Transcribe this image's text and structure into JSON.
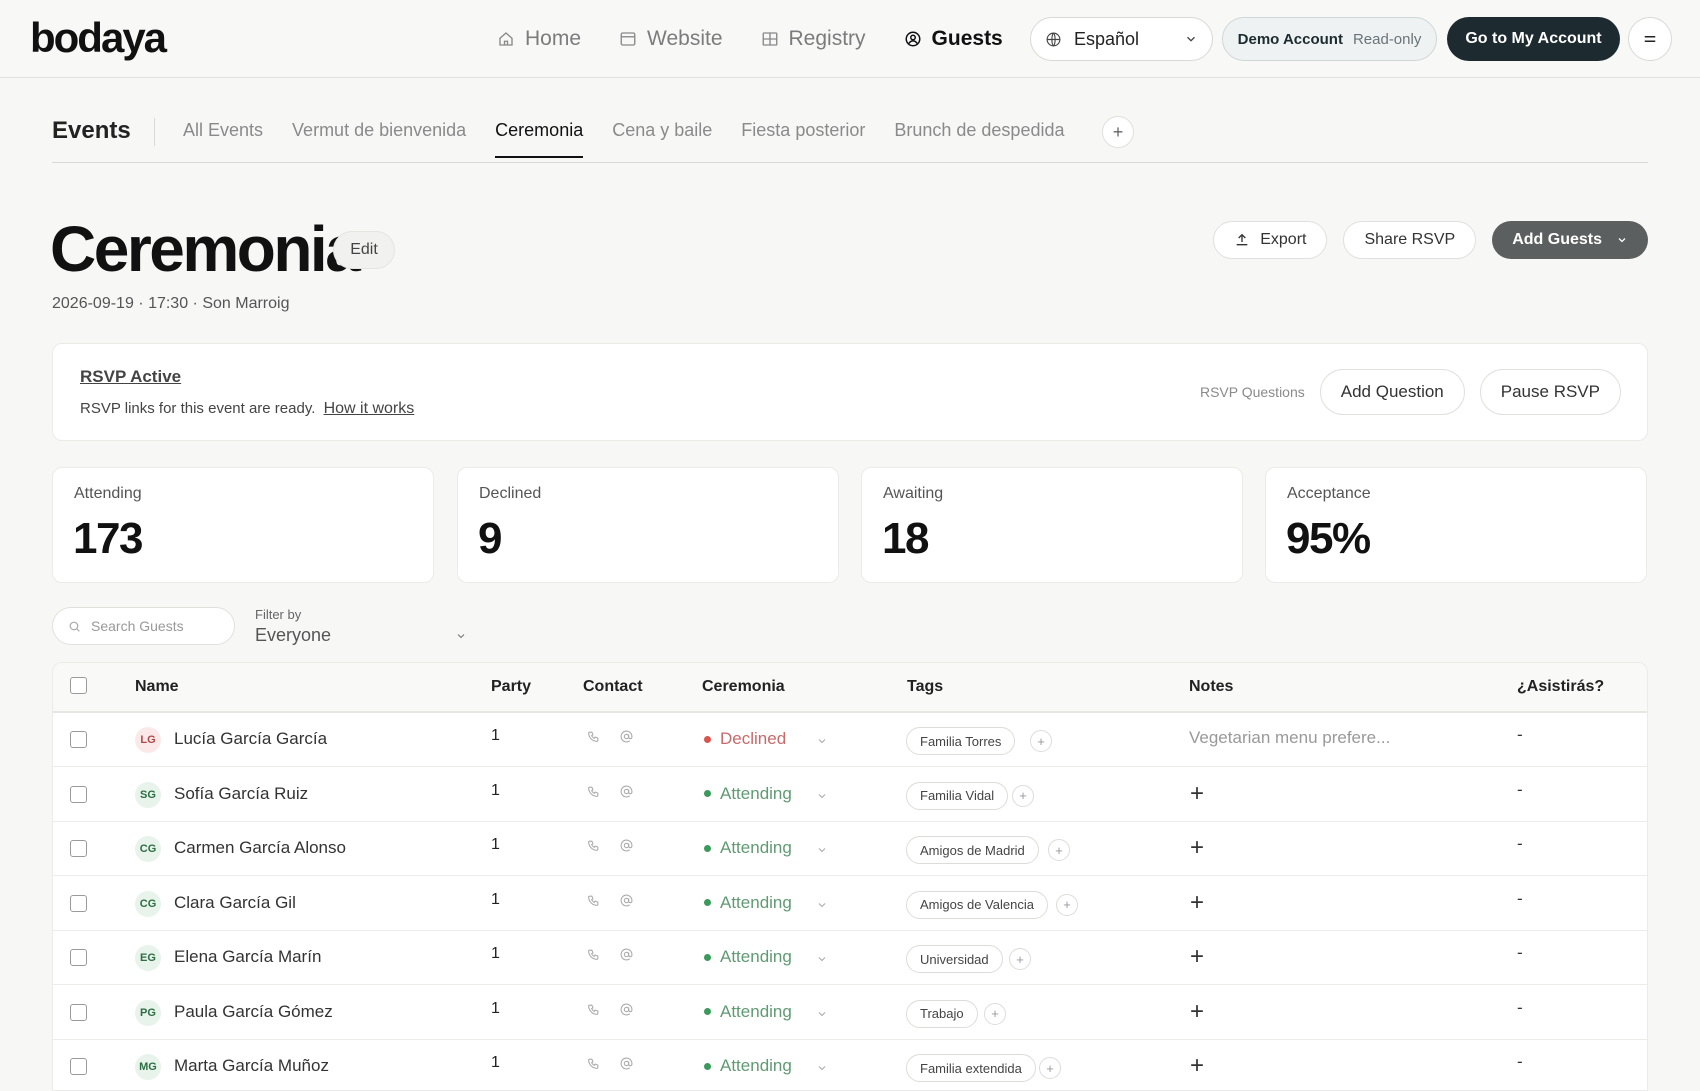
{
  "app": {
    "logo": "bodaya",
    "nav": [
      {
        "label": "Home",
        "icon": "home-icon"
      },
      {
        "label": "Website",
        "icon": "browser-icon"
      },
      {
        "label": "Registry",
        "icon": "gift-icon"
      },
      {
        "label": "Guests",
        "icon": "user-circle-icon",
        "active": true
      }
    ],
    "language": "Español",
    "demo_label": "Demo Account",
    "demo_mode": "Read-only",
    "go_to_account": "Go to My Account"
  },
  "events": {
    "title": "Events",
    "tabs": [
      "All Events",
      "Vermut de bienvenida",
      "Ceremonia",
      "Cena y baile",
      "Fiesta posterior",
      "Brunch de despedida"
    ],
    "active_tab": "Ceremonia",
    "add_tab": "+"
  },
  "page": {
    "title": "Ceremonia",
    "edit": "Edit",
    "meta": "2026-09-19 · 17:30 · Son Marroig",
    "export": "Export",
    "share": "Share RSVP",
    "add_guests": "Add Guests"
  },
  "rsvp": {
    "status": "RSVP Active",
    "description": "RSVP links for this event are ready.",
    "how_link": "How it works",
    "questions_label": "RSVP Questions",
    "add_question": "Add Question",
    "pause": "Pause RSVP"
  },
  "stats": [
    {
      "label": "Attending",
      "value": "173"
    },
    {
      "label": "Declined",
      "value": "9"
    },
    {
      "label": "Awaiting",
      "value": "18"
    },
    {
      "label": "Acceptance",
      "value": "95%"
    }
  ],
  "filters": {
    "search_placeholder": "Search Guests",
    "filter_label": "Filter by",
    "filter_value": "Everyone"
  },
  "table": {
    "columns": [
      "Name",
      "Party",
      "Contact",
      "Ceremonia",
      "Tags",
      "Notes",
      "¿Asistirás?"
    ],
    "rows": [
      {
        "initials": "LG",
        "name": "Lucía García García",
        "party": "1",
        "status": "Declined",
        "tag": "Familia Torres",
        "note": "Vegetarian menu prefere...",
        "asist": "-"
      },
      {
        "initials": "SG",
        "name": "Sofía García Ruiz",
        "party": "1",
        "status": "Attending",
        "tag": "Familia Vidal",
        "note": "",
        "asist": "-"
      },
      {
        "initials": "CG",
        "name": "Carmen García Alonso",
        "party": "1",
        "status": "Attending",
        "tag": "Amigos de Madrid",
        "note": "",
        "asist": "-"
      },
      {
        "initials": "CG",
        "name": "Clara García Gil",
        "party": "1",
        "status": "Attending",
        "tag": "Amigos de Valencia",
        "note": "",
        "asist": "-"
      },
      {
        "initials": "EG",
        "name": "Elena García Marín",
        "party": "1",
        "status": "Attending",
        "tag": "Universidad",
        "note": "",
        "asist": "-"
      },
      {
        "initials": "PG",
        "name": "Paula García Gómez",
        "party": "1",
        "status": "Attending",
        "tag": "Trabajo",
        "note": "",
        "asist": "-"
      },
      {
        "initials": "MG",
        "name": "Marta García Muñoz",
        "party": "1",
        "status": "Attending",
        "tag": "Familia extendida",
        "note": "",
        "asist": "-"
      }
    ]
  },
  "colors": {
    "declined": "#d9534f",
    "attending": "#3a9a5b",
    "avatar_declined_bg": "#fbe9e9",
    "avatar_declined_fg": "#b14848",
    "avatar_attending_bg": "#e8f3eb",
    "avatar_attending_fg": "#2d6e43",
    "status_text_declined": "#c76a6a",
    "status_text_attending": "#5f9a72"
  }
}
